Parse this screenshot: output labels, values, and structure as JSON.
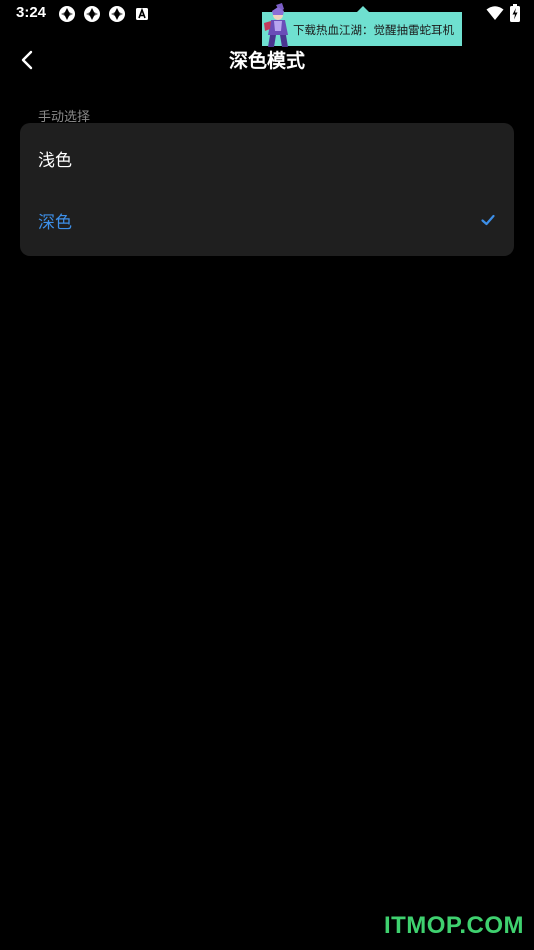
{
  "status_bar": {
    "time": "3:24",
    "icons": [
      "app-notification-icon",
      "app-notification-icon",
      "app-notification-icon",
      "a-notification-icon"
    ],
    "right_icons": [
      "wifi-icon",
      "battery-charging-icon"
    ]
  },
  "ad_banner": {
    "text": "下载热血江湖：觉醒抽雷蛇耳机",
    "background_color": "#6fe0d0"
  },
  "header": {
    "title": "深色模式",
    "back_icon": "chevron-left-icon"
  },
  "section": {
    "label": "手动选择",
    "options": [
      {
        "label": "浅色",
        "selected": false
      },
      {
        "label": "深色",
        "selected": true
      }
    ]
  },
  "colors": {
    "background": "#000000",
    "card": "#1f1f1f",
    "accent": "#3d8fe8",
    "watermark": "#3fd16f"
  },
  "watermark": {
    "text": "ITMOP.COM"
  }
}
